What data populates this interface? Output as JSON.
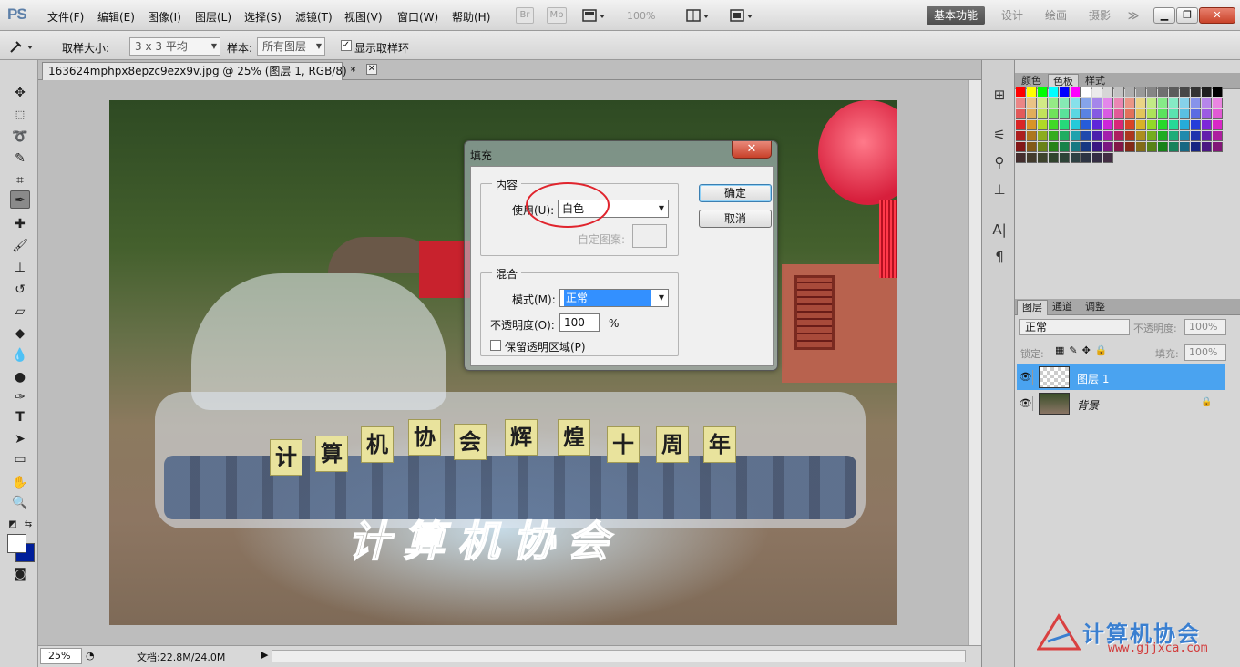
{
  "app": {
    "logo": "PS",
    "menu": [
      "文件(F)",
      "编辑(E)",
      "图像(I)",
      "图层(L)",
      "选择(S)",
      "滤镜(T)",
      "视图(V)",
      "窗口(W)",
      "帮助(H)"
    ],
    "bridge_label": "Br",
    "minibridge_label": "Mb",
    "zoom_display": "100%",
    "workspaces": [
      "基本功能",
      "设计",
      "绘画",
      "摄影"
    ],
    "more_workspaces": "≫"
  },
  "options_bar": {
    "sample_size_label": "取样大小:",
    "sample_size_value": "3 x 3 平均",
    "sample_label": "样本:",
    "sample_value": "所有图层",
    "show_ring_label": "显示取样环",
    "show_ring_checked": true
  },
  "document": {
    "tab_title": "163624mphpx8epzc9ezx9v.jpg @ 25% (图层 1, RGB/8) *",
    "status_zoom": "25%",
    "status_doc": "文档:22.8M/24.0M"
  },
  "photo": {
    "signs": [
      "计",
      "算",
      "机",
      "协",
      "会",
      "辉",
      "煌",
      "十",
      "周",
      "年"
    ],
    "selection_text": "计算机协会"
  },
  "fill_dialog": {
    "title": "填充",
    "contents_legend": "内容",
    "use_label": "使用(U):",
    "use_value": "白色",
    "custom_pattern_label": "自定图案:",
    "blend_legend": "混合",
    "mode_label": "模式(M):",
    "mode_value": "正常",
    "opacity_label": "不透明度(O):",
    "opacity_value": "100",
    "opacity_unit": "%",
    "preserve_label": "保留透明区域(P)",
    "preserve_checked": false,
    "ok_label": "确定",
    "cancel_label": "取消"
  },
  "panels": {
    "color_tabs": [
      "颜色",
      "色板",
      "样式"
    ],
    "color_active": "色板",
    "layer_tabs": [
      "图层",
      "通道",
      "调整"
    ],
    "layer_active": "图层",
    "blend_mode": "正常",
    "opacity_label": "不透明度:",
    "opacity_value": "100%",
    "lock_label": "锁定:",
    "fill_label": "填充:",
    "fill_value": "100%",
    "layers": [
      {
        "name": "图层 1",
        "selected": true
      },
      {
        "name": "背景",
        "selected": false,
        "locked": true
      }
    ]
  },
  "watermark": {
    "text": "计算机协会",
    "url": "www.gjjxca.com"
  },
  "colors": {
    "accent_selected": "#3390ff",
    "background_swatch": "#001e9a",
    "foreground_swatch": "#ffffff",
    "annotation_circle": "#e0242d"
  }
}
